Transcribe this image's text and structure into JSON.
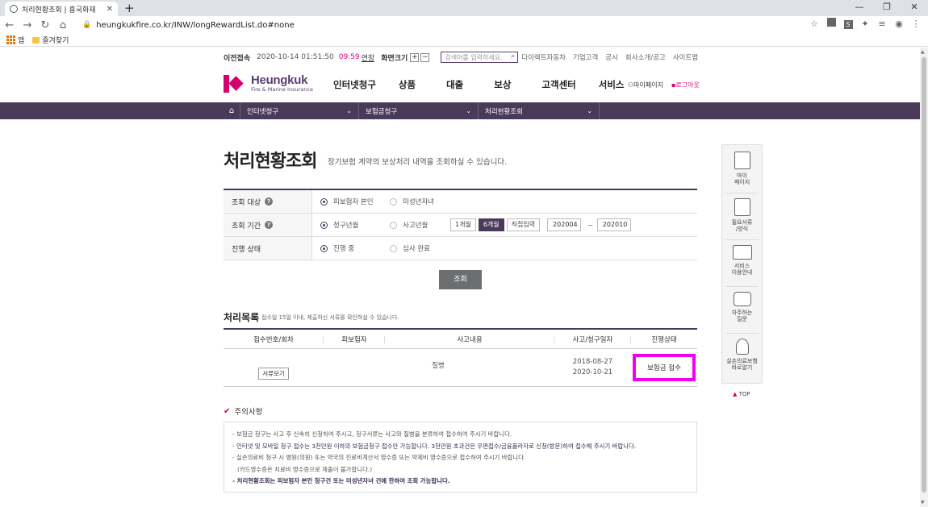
{
  "browser": {
    "tab_title": "처리현황조회 | 흥국화재",
    "url": "heungkukfire.co.kr/INW/longRewardList.do#none",
    "bookmarks": [
      "앱",
      "즐겨찾기"
    ]
  },
  "utility": {
    "prev_login_label": "이전접속",
    "login_time": "2020-10-14 01:51:50",
    "timer": "09:59",
    "extend": "연장",
    "zoom_label": "화면크기",
    "zoom_in": "+",
    "zoom_out": "−",
    "search_placeholder": "검색어를 입력하세요.",
    "links": [
      "다이렉트자동차",
      "기업고객",
      "공시",
      "회사소개/공고",
      "사이트맵"
    ]
  },
  "header": {
    "logo_name": "Heungkuk",
    "logo_sub": "Fire & Marine Insurance",
    "gnb": [
      "인터넷청구",
      "상품",
      "대출",
      "보상",
      "고객센터",
      "서비스"
    ],
    "mypage": "마이페이지",
    "logout": "로그아웃"
  },
  "breadcrumb": [
    "인터넷청구",
    "보험금청구",
    "처리현황조회"
  ],
  "page": {
    "title": "처리현황조회",
    "desc": "장기보험 계약의 보상처리 내역을 조회하실 수 있습니다."
  },
  "form": {
    "target_label": "조회 대상",
    "target_options": [
      "피보험자 본인",
      "미성년자녀"
    ],
    "period_label": "조회 기간",
    "period_options": [
      "청구년월",
      "사고년월"
    ],
    "period_buttons": [
      "1개월",
      "6개월",
      "직접입력"
    ],
    "date_from": "202004",
    "date_sep": "~",
    "date_to": "202010",
    "status_label": "진행 상태",
    "status_options": [
      "진행 중",
      "심사 완료"
    ],
    "query_button": "조회"
  },
  "list": {
    "title": "처리목록",
    "desc": "접수일 15일 이내, 제출하신 서류를 확인하실 수 있습니다.",
    "columns": [
      "접수번호/회차",
      "피보험자",
      "사고내용",
      "사고/청구일자",
      "진행상태"
    ],
    "rows": [
      {
        "doc_button": "서류보기",
        "insured": "",
        "accident": "질병",
        "accident_date": "2018-08-27",
        "claim_date": "2020-10-21",
        "status": "보험금 접수"
      }
    ]
  },
  "notice": {
    "title": "주의사항",
    "lines": [
      "- 보험금 청구는 사고 후 신속히 신청하여 주시고, 청구서류는 사고와 질병을 분류하여 접수하여 주시기 바랍니다.",
      "- 인터넷 및 모바일 청구 접수는 3천만원 이하의 보험금청구 접수만 가능합니다. 3천만원 초과건은 우편접수/금융플라자로 신청(방문)하여 접수해 주시기 바랍니다.",
      "- 실손의료비 청구 시 병원(의원) 또는 약국의 진료비계산서 영수증 또는 약제비 영수증으로 접수하여 주시기 바랍니다.",
      "(카드영수증은 치료비 영수증으로 제출이 불가합니다.)",
      "- 처리현황조회는 피보험자 본인 청구건 또는 미성년자녀 건에 한하여 조회 가능합니다."
    ]
  },
  "quick_menu": [
    "마이\n페이지",
    "필요서류\n/양식",
    "서비스\n이용안내",
    "자주하는\n질문",
    "실손의료보험\n바로알기"
  ],
  "top_label": "TOP",
  "colors": {
    "brand_purple": "#4a3a5a",
    "brand_pink": "#d6006d",
    "highlight": "#ee00ee"
  }
}
